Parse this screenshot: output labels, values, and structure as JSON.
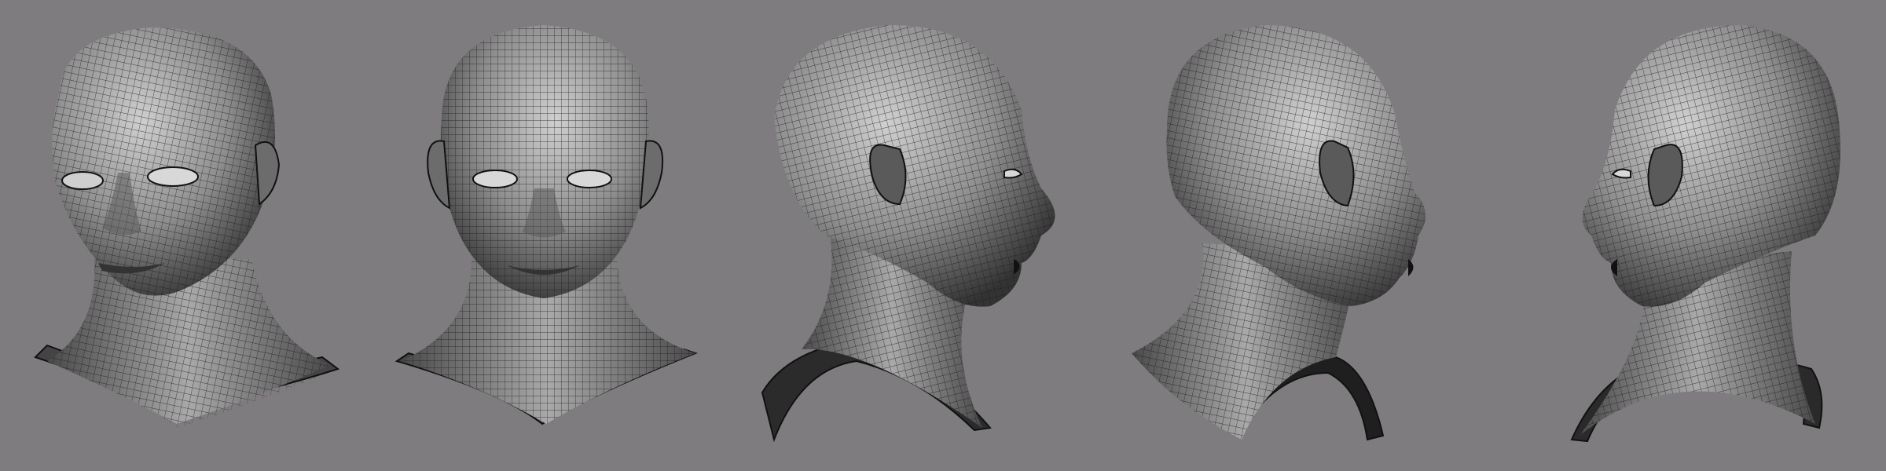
{
  "scene": {
    "background_color": "#7e7c7f",
    "views": [
      {
        "id": "three-quarter-left",
        "icon": "head-3q-left"
      },
      {
        "id": "front",
        "icon": "head-front"
      },
      {
        "id": "profile-right",
        "icon": "head-profile-right"
      },
      {
        "id": "three-quarter-back-right",
        "icon": "head-back-3q-right"
      },
      {
        "id": "profile-left",
        "icon": "head-profile-left"
      }
    ],
    "colors": {
      "skin_light": "#c9c9c9",
      "skin_mid": "#8e8e8e",
      "skin_dark": "#3a3a3a",
      "wire": "#1b1b1b",
      "cavity": "#111111",
      "eye_white": "#d8d8d8"
    }
  }
}
